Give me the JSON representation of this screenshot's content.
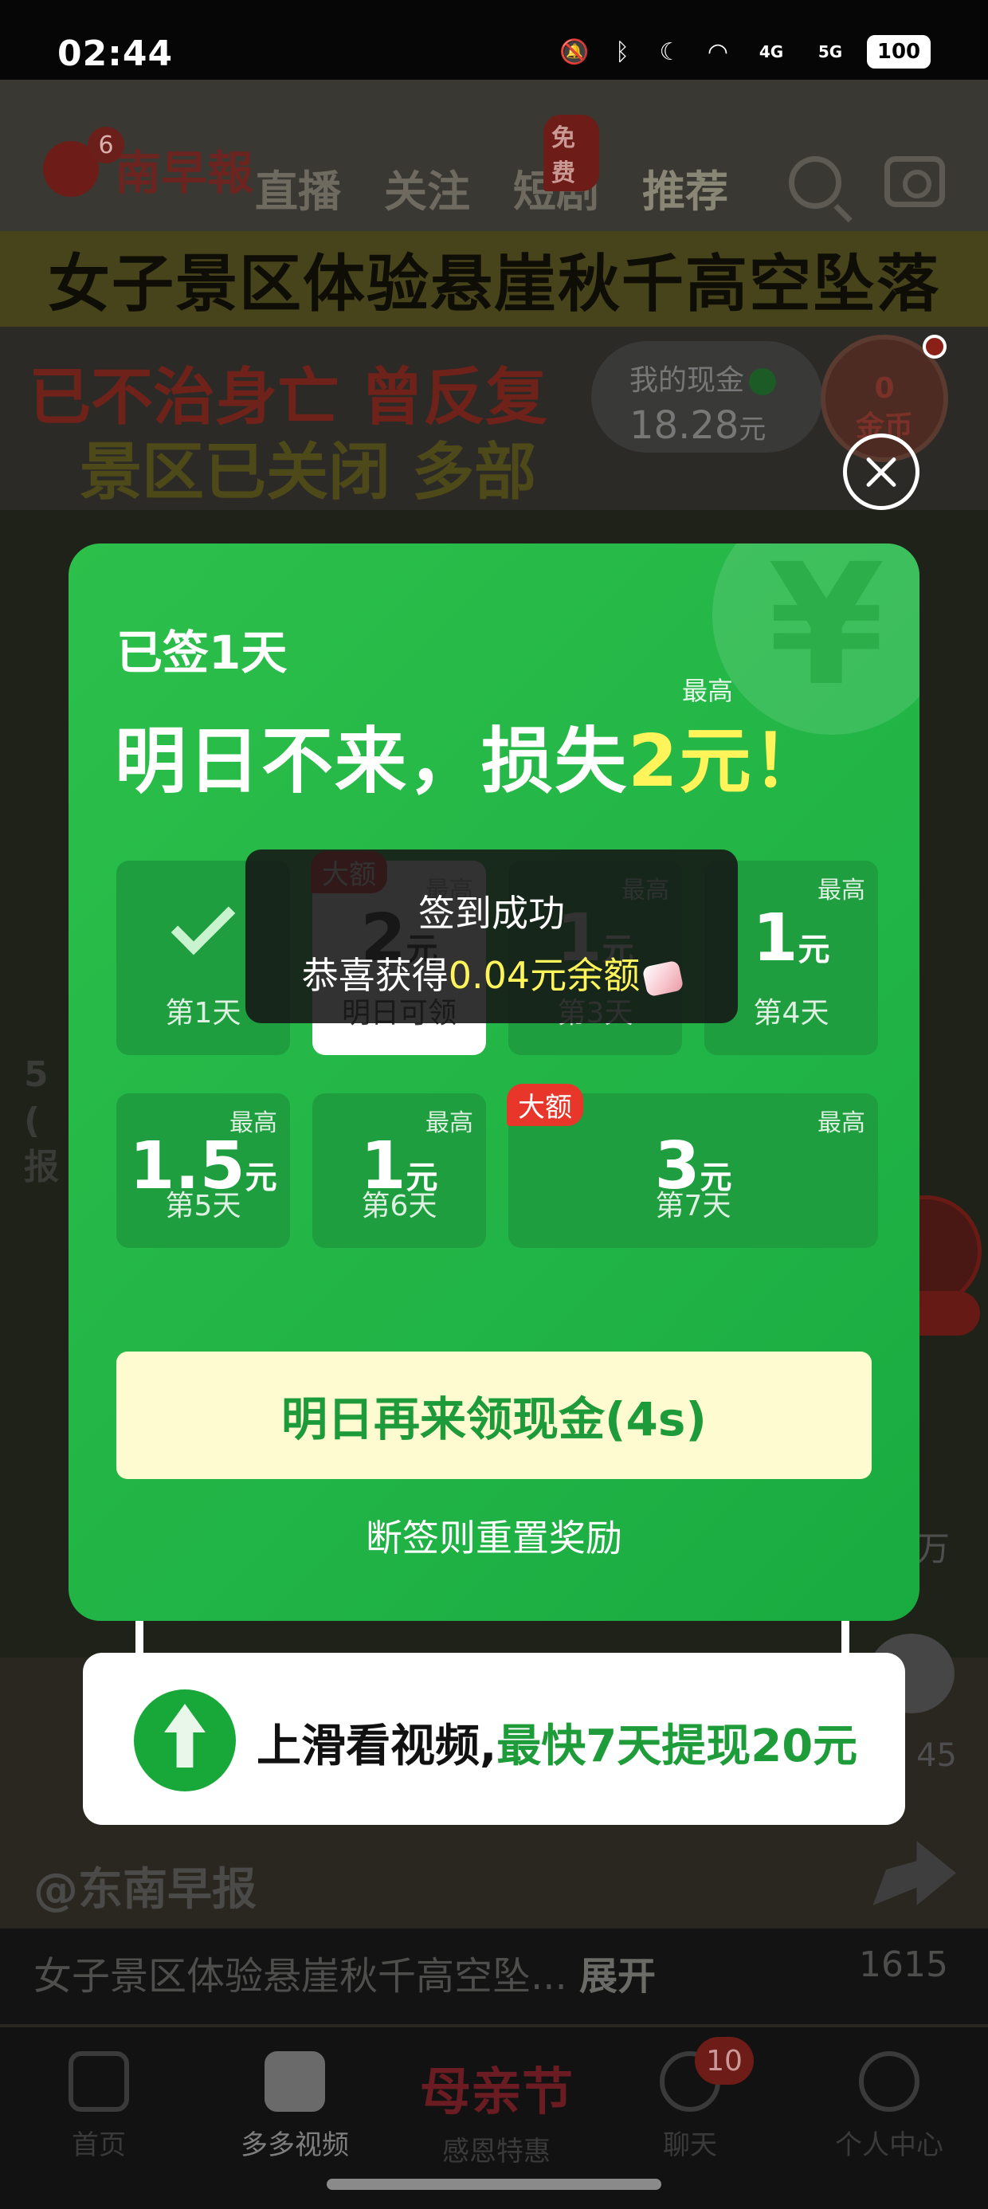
{
  "status_bar": {
    "time": "02:44",
    "icons": [
      "bell-off-icon",
      "bluetooth-icon",
      "moon-icon",
      "wifi-icon",
      "4g-signal-icon",
      "5g-signal-icon"
    ],
    "signal_4g": "4G",
    "signal_5g": "5G",
    "battery": "100"
  },
  "top_bar": {
    "logo_badge": "6",
    "logo_text": "南早報",
    "tabs": [
      {
        "label": "直播"
      },
      {
        "label": "关注"
      },
      {
        "label": "短剧",
        "badge": "免费"
      },
      {
        "label": "推荐",
        "active": true
      }
    ]
  },
  "video": {
    "headline": "女子景区体验悬崖秋千高空坠落",
    "subline1": "已不治身亡 曾反复",
    "subline2": "景区已关闭 多部",
    "side_text": [
      "5",
      "(",
      "报"
    ],
    "author": "@东南早报",
    "description": "女子景区体验悬崖秋千高空坠...",
    "expand": "展开",
    "likes": "1615",
    "count_right_1": "万",
    "count_right_2": "45"
  },
  "cash_widget": {
    "label": "我的现金",
    "amount": "18.28",
    "unit": "元",
    "coin_count": "0",
    "coin_label": "金币"
  },
  "modal": {
    "signed_days": "已签1天",
    "loss_prefix": "明日不来，损失",
    "loss_amount": "2元！",
    "max_label": "最高",
    "days": [
      {
        "label": "第1天",
        "checked": true
      },
      {
        "label": "明日可领",
        "amount": "2",
        "unit": "元",
        "top": "最高",
        "badge": "大额",
        "today": true
      },
      {
        "label": "第3天",
        "amount": "1",
        "unit": "元",
        "top": "最高"
      },
      {
        "label": "第4天",
        "amount": "1",
        "unit": "元",
        "top": "最高"
      },
      {
        "label": "第5天",
        "amount": "1.5",
        "unit": "元",
        "top": "最高"
      },
      {
        "label": "第6天",
        "amount": "1",
        "unit": "元",
        "top": "最高"
      },
      {
        "label": "第7天",
        "amount": "3",
        "unit": "元",
        "top": "最高",
        "badge": "大额"
      }
    ],
    "toast": {
      "title": "签到成功",
      "prefix": "恭喜获得",
      "amount": "0.04元余额"
    },
    "cta": "明日再来领现金(4s)",
    "reset_note": "断签则重置奖励"
  },
  "promo": {
    "text": "上滑看视频,",
    "highlight": "最快7天提现20元"
  },
  "bottom_nav": {
    "items": [
      {
        "label": "首页"
      },
      {
        "label": "多多视频",
        "active": true
      },
      {
        "label": "母亲节",
        "sub": "感恩特惠"
      },
      {
        "label": "聊天",
        "badge": "10"
      },
      {
        "label": "个人中心"
      }
    ]
  },
  "colors": {
    "card_green": "#21b446",
    "cta_bg": "#fffbd0",
    "cta_text": "#1d9a3a",
    "highlight_yellow": "#fff45a",
    "badge_red": "#e8362b"
  }
}
